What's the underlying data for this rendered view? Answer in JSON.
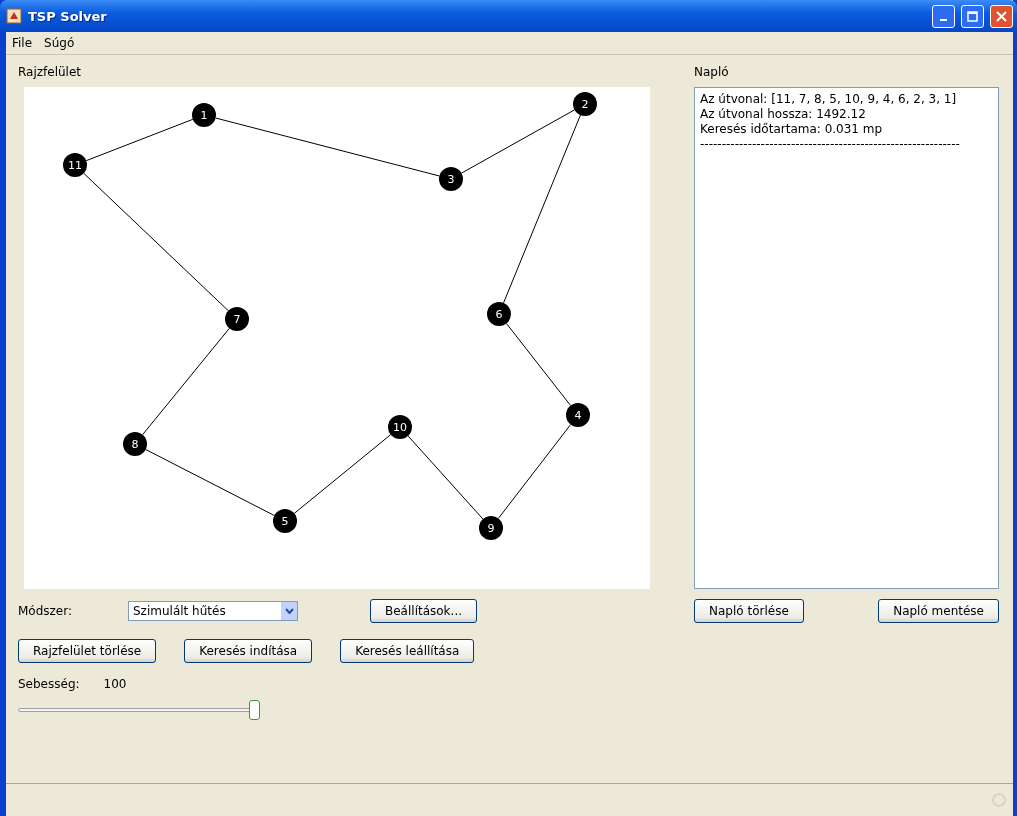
{
  "window": {
    "title": "TSP Solver"
  },
  "menu": [
    "File",
    "Súgó"
  ],
  "canvas": {
    "label": "Rajzfelület",
    "tour": [
      "11",
      "7",
      "8",
      "5",
      "10",
      "9",
      "4",
      "6",
      "2",
      "3",
      "1"
    ]
  },
  "method": {
    "label": "Módszer:",
    "value": "Szimulált hűtés",
    "settings_button": "Beállítások..."
  },
  "buttons": [
    "Rajzfelület törlése",
    "Keresés indítása",
    "Keresés leállítása"
  ],
  "speed": {
    "label": "Sebesség:",
    "reading": "100",
    "level": 1
  },
  "log": {
    "label": "Napló",
    "lines": [
      "Az útvonal: [11, 7, 8, 5, 10, 9, 4, 6, 2, 3, 1]",
      "Az útvonal hossza: 1492.12",
      "Keresés időtartama: 0.031 mp",
      "------------------------------------------------------------"
    ],
    "buttons": [
      "Napló törlése",
      "Napló mentése"
    ]
  }
}
